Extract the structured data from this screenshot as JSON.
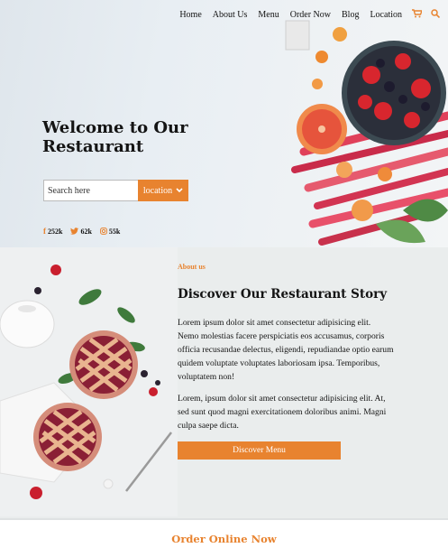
{
  "nav": {
    "items": [
      "Home",
      "About Us",
      "Menu",
      "Order Now",
      "Blog",
      "Location"
    ],
    "cart_icon": "cart-icon",
    "search_icon": "search-icon"
  },
  "hero": {
    "title": "Welcome to Our Restaurant",
    "search_placeholder": "Search here",
    "location_label": "location",
    "location_icon": "chevron-down-icon",
    "socials": [
      {
        "icon": "facebook-icon",
        "count": "252k"
      },
      {
        "icon": "twitter-icon",
        "count": "62k"
      },
      {
        "icon": "instagram-icon",
        "count": "55k"
      }
    ]
  },
  "about": {
    "kicker": "About us",
    "title": "Discover Our Restaurant Story",
    "paragraph1": "Lorem ipsum dolor sit amet consectetur adipisicing elit. Nemo molestias facere perspiciatis eos accusamus, corporis officia recusandae delectus, eligendi, repudiandae optio earum quidem voluptate voluptates laboriosam ipsa. Temporibus, voluptatem non!",
    "paragraph2": "Lorem, ipsum dolor sit amet consectetur adipisicing elit. At, sed sunt quod magni exercitationem doloribus animi. Magni culpa saepe dicta.",
    "button_label": "Discover Menu"
  },
  "order": {
    "title": "Order Online Now"
  },
  "colors": {
    "accent": "#e8832f"
  }
}
